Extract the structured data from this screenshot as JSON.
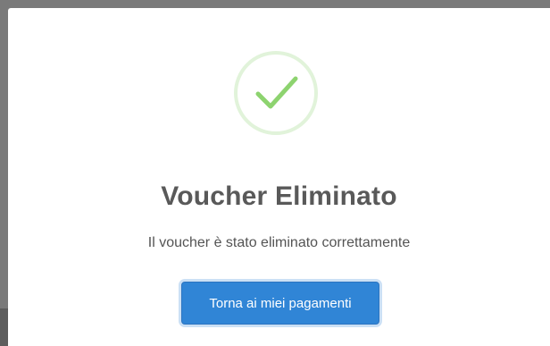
{
  "dialog": {
    "icon": "checkmark-icon",
    "title": "Voucher Eliminato",
    "message": "Il voucher è stato eliminato correttamente",
    "confirm_button_label": "Torna ai miei pagamenti"
  },
  "colors": {
    "accent": "#3085d6",
    "success_check": "#8dd36f",
    "success_ring": "#e1f3da",
    "overlay": "#7a7a7a"
  }
}
